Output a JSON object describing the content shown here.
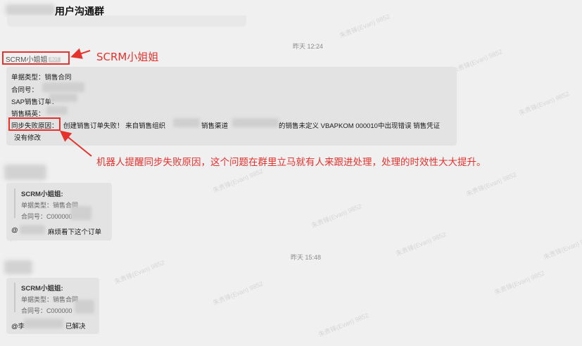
{
  "header": {
    "group_title": "用户沟通群"
  },
  "messages": {
    "time_1": "昨天 12:24",
    "time_2": "昨天 15:48",
    "bot_sender": "SCRM小姐姐",
    "bot_tag": "BOT",
    "bot_message": {
      "line_1": "单据类型：销售合同",
      "line_2": "合同号：",
      "line_3": "SAP销售订单：",
      "line_4": "销售精英：",
      "fail_label": "同步失败原因：",
      "fail_text": "创建销售订单失败！ 来自销售组织",
      "fail_text_2": "销售渠道",
      "fail_text_3": "的销售未定义 VBAPKOM 000010中出现错误 销售凭证",
      "line_6": "没有修改"
    },
    "reply_1": {
      "quote_sender": "SCRM小姐姐:",
      "quote_line_1": "单据类型：销售合同",
      "quote_line_2": "合同号：C000000",
      "text_prefix": "@",
      "text": "麻烦看下这个订单"
    },
    "reply_2": {
      "quote_sender": "SCRM小姐姐:",
      "quote_line_1": "单据类型：销售合同",
      "quote_line_2": "合同号：C000000",
      "text_prefix": "@李",
      "text": "已解决"
    }
  },
  "annotations": {
    "label_1": "SCRM小姐姐",
    "label_2": "机器人提醒同步失败原因，这个问题在群里立马就有人来跟进处理，处理的时效性大大提升。",
    "color": "#e5322d"
  },
  "watermark": "朱贵锋(Evan) 9852"
}
